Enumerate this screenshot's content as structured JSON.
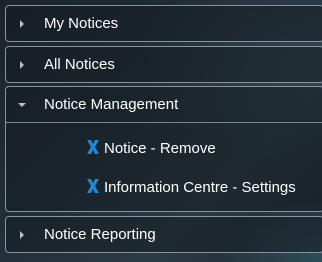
{
  "menu": {
    "sections": [
      {
        "label": "My Notices",
        "expanded": false
      },
      {
        "label": "All Notices",
        "expanded": false
      },
      {
        "label": "Notice Management",
        "expanded": true
      },
      {
        "label": "Notice Reporting",
        "expanded": false
      }
    ],
    "notice_management_items": [
      {
        "label": "Notice - Remove",
        "icon": "x-icon"
      },
      {
        "label": "Information Centre - Settings",
        "icon": "x-icon"
      }
    ]
  },
  "colors": {
    "text": "#ffffff",
    "border": "#8a9399",
    "icon_blue": "#1e88d6",
    "arrow": "#b9c0c4"
  }
}
